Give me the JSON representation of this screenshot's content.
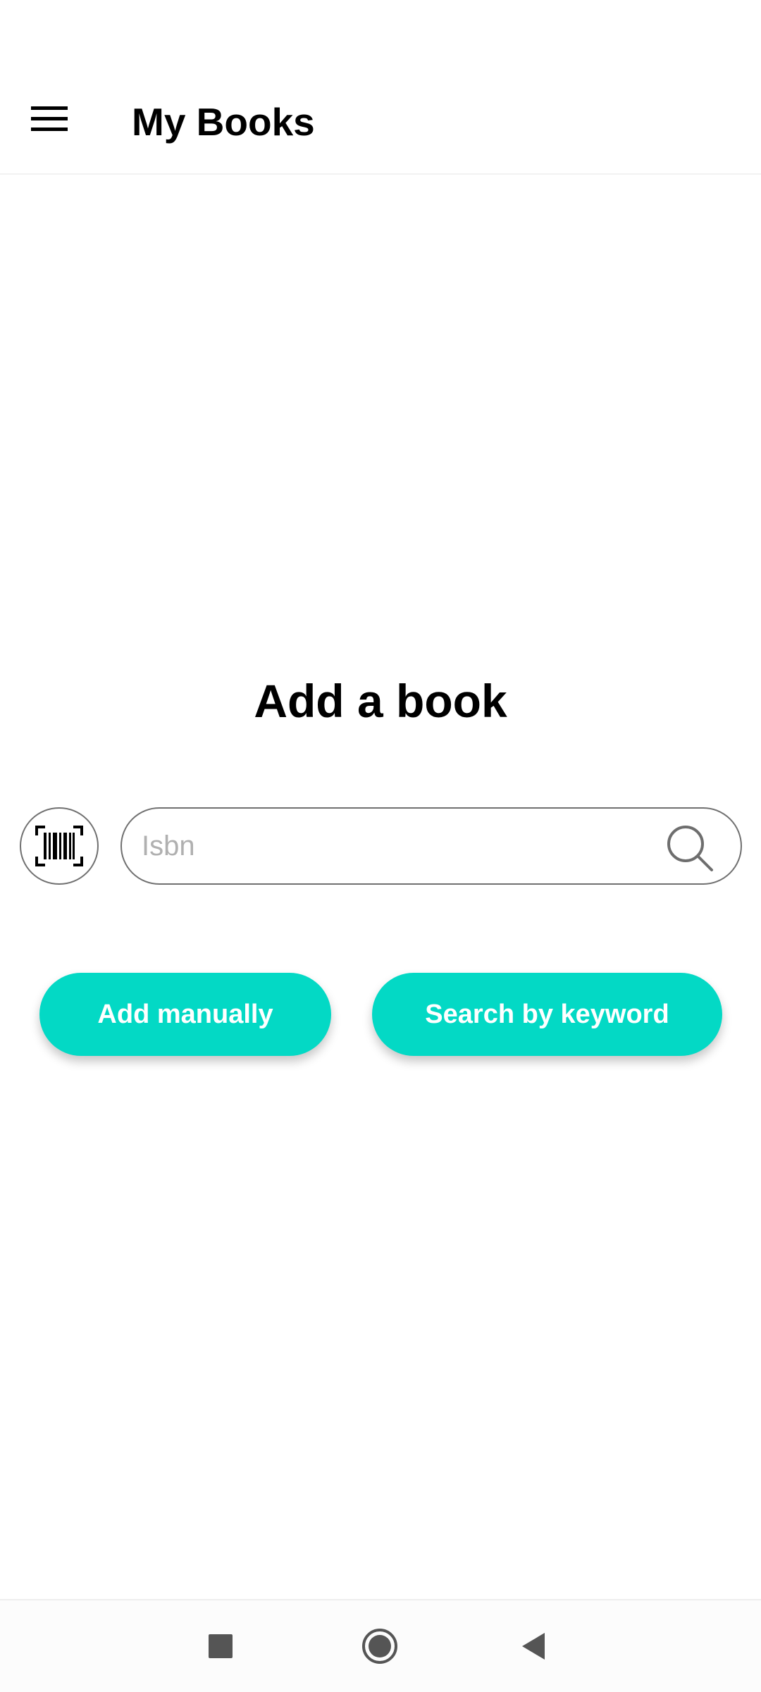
{
  "app_bar": {
    "title": "My Books",
    "menu_icon": "hamburger-menu-icon"
  },
  "main": {
    "heading": "Add a book",
    "barcode_icon": "barcode-scan-icon",
    "isbn_search": {
      "placeholder": "Isbn",
      "value": "",
      "icon": "search-icon"
    },
    "buttons": {
      "add_manually": "Add manually",
      "search_by_keyword": "Search by keyword"
    }
  },
  "navigation_bar": {
    "recents_icon": "square-recents-icon",
    "home_icon": "circle-home-icon",
    "back_icon": "triangle-back-icon"
  },
  "colors": {
    "accent": "#03d9c5",
    "outline": "#707070",
    "text": "#000000",
    "placeholder": "#b0b0b0",
    "nav_icon": "#555555"
  }
}
